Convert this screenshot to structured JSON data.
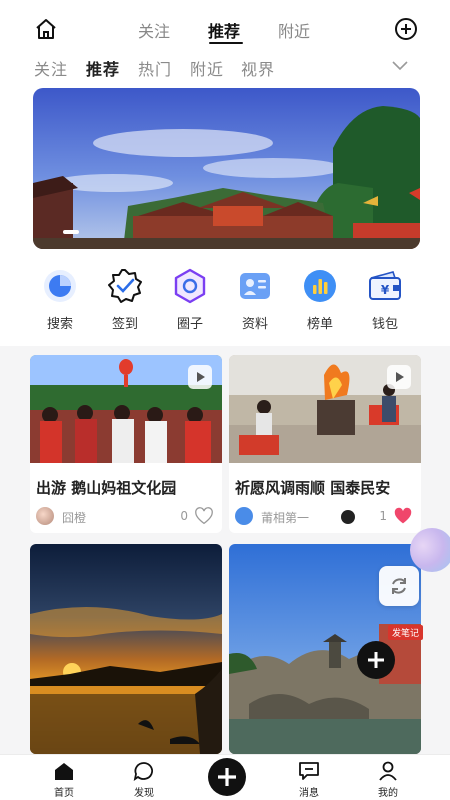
{
  "top_tabs": [
    {
      "label": "关注"
    },
    {
      "label": "推荐",
      "active": true
    },
    {
      "label": "附近"
    }
  ],
  "icons": {
    "home": "home-icon",
    "add": "plus-circle-icon",
    "expand": "chevron-down-icon"
  },
  "sub_tabs": [
    {
      "label": "关注"
    },
    {
      "label": "推荐",
      "active": true
    },
    {
      "label": "热门"
    },
    {
      "label": "附近"
    },
    {
      "label": "视界"
    }
  ],
  "banner": {
    "carousel_index": 1
  },
  "quick_menu": [
    {
      "label": "搜索",
      "icon": "search-pie-icon"
    },
    {
      "label": "签到",
      "icon": "checkin-badge-icon"
    },
    {
      "label": "圈子",
      "icon": "circle-hexagon-icon"
    },
    {
      "label": "资料",
      "icon": "profile-card-icon"
    },
    {
      "label": "榜单",
      "icon": "ranking-chart-icon"
    },
    {
      "label": "钱包",
      "icon": "wallet-icon"
    }
  ],
  "feed": [
    {
      "title": "出游 鹅山妈祖文化园",
      "author": "囧橙",
      "likes": "0",
      "liked": false,
      "is_video": true
    },
    {
      "title": "祈愿风调雨顺 国泰民安",
      "author": "莆相第一",
      "likes": "1",
      "liked": true,
      "is_video": true
    }
  ],
  "feed_extra": {
    "note_tag": "发笔记"
  },
  "bottom_nav": [
    {
      "label": "首页",
      "icon": "home-filled-icon"
    },
    {
      "label": "发现",
      "icon": "discover-chat-icon"
    },
    {
      "label": "",
      "icon": "publish-plus-icon"
    },
    {
      "label": "消息",
      "icon": "message-icon"
    },
    {
      "label": "我的",
      "icon": "profile-icon"
    }
  ],
  "colors": {
    "accent": "#111111",
    "like": "#f0466b",
    "inactive": "#8a8a8a"
  }
}
